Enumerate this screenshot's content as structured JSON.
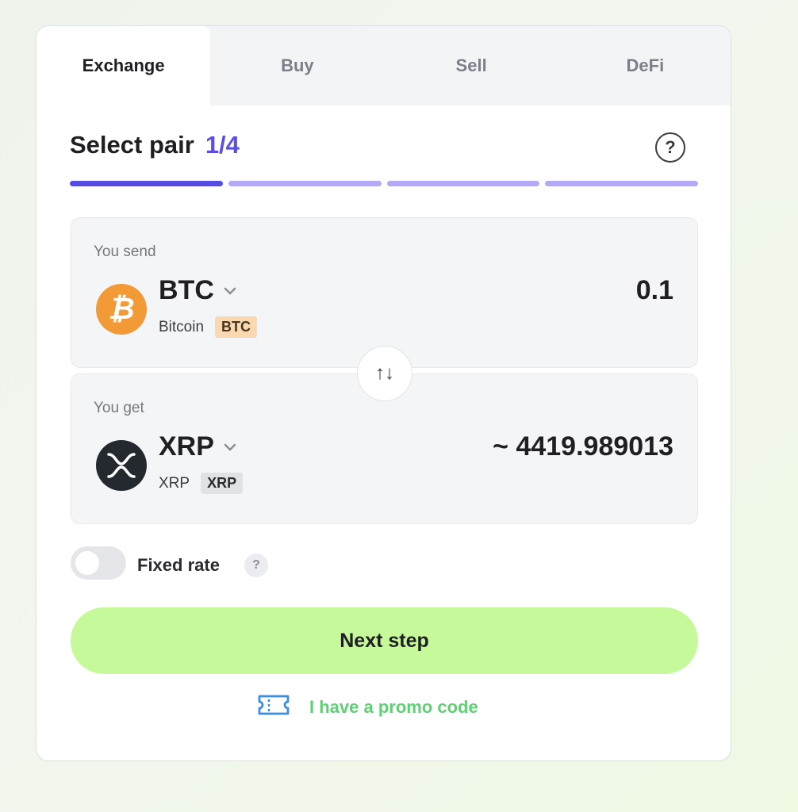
{
  "tabs": [
    {
      "label": "Exchange",
      "active": true
    },
    {
      "label": "Buy",
      "active": false
    },
    {
      "label": "Sell",
      "active": false
    },
    {
      "label": "DeFi",
      "active": false
    }
  ],
  "step": {
    "title": "Select pair",
    "counter": "1/4",
    "help_icon": "?",
    "progress_done": 1,
    "progress_total": 4
  },
  "send": {
    "label": "You send",
    "icon": "bitcoin-icon",
    "icon_glyph": "₿",
    "ticker": "BTC",
    "name": "Bitcoin",
    "network": "BTC",
    "amount": "0.1"
  },
  "swap": {
    "icon": "swap-arrows-icon",
    "glyph": "↑↓"
  },
  "get": {
    "label": "You get",
    "icon": "xrp-icon",
    "ticker": "XRP",
    "name": "XRP",
    "network": "XRP",
    "amount": "~ 4419.989013"
  },
  "fixed_rate": {
    "label": "Fixed rate",
    "enabled": false,
    "help_icon": "?"
  },
  "next_button": {
    "label": "Next step"
  },
  "promo": {
    "label": "I have a promo code",
    "icon": "ticket-icon"
  },
  "colors": {
    "accent": "#574ce0",
    "progress_pending": "#b3aaf5",
    "cta": "#c6f99a",
    "promo_text": "#5fcf74",
    "btc": "#f29a36",
    "xrp": "#23292f"
  }
}
